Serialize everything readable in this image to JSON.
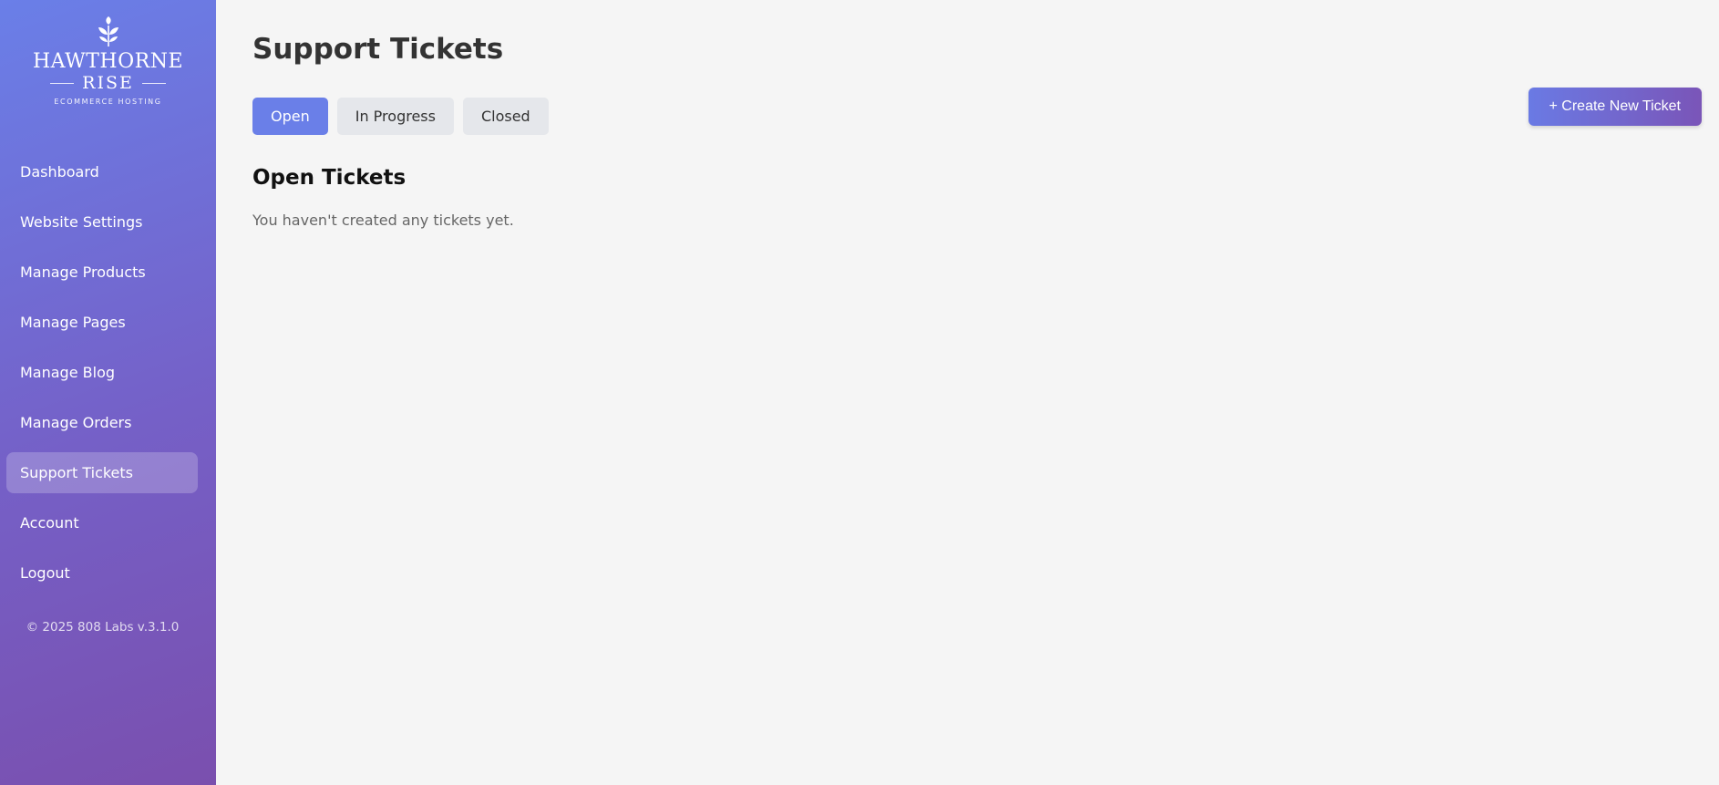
{
  "brand": {
    "name_line1": "HAWTHORNE",
    "name_line2": "RISE",
    "tagline": "ECOMMERCE HOSTING",
    "logo_icon": "leaf-sprig-icon"
  },
  "sidebar": {
    "items": [
      {
        "label": "Dashboard",
        "active": false
      },
      {
        "label": "Website Settings",
        "active": false
      },
      {
        "label": "Manage Products",
        "active": false
      },
      {
        "label": "Manage Pages",
        "active": false
      },
      {
        "label": "Manage Blog",
        "active": false
      },
      {
        "label": "Manage Orders",
        "active": false
      },
      {
        "label": "Support Tickets",
        "active": true
      },
      {
        "label": "Account",
        "active": false
      },
      {
        "label": "Logout",
        "active": false
      }
    ],
    "footer": "© 2025 808 Labs v.3.1.0"
  },
  "main": {
    "title": "Support Tickets",
    "tabs": [
      {
        "label": "Open",
        "active": true
      },
      {
        "label": "In Progress",
        "active": false
      },
      {
        "label": "Closed",
        "active": false
      }
    ],
    "create_button_label": "+ Create New Ticket",
    "section_title": "Open Tickets",
    "empty_message": "You haven't created any tickets yet."
  },
  "colors": {
    "accent": "#6a7fe8",
    "sidebar_gradient_start": "#6a7fe8",
    "sidebar_gradient_end": "#7a4fae",
    "background": "#f5f5f5"
  }
}
